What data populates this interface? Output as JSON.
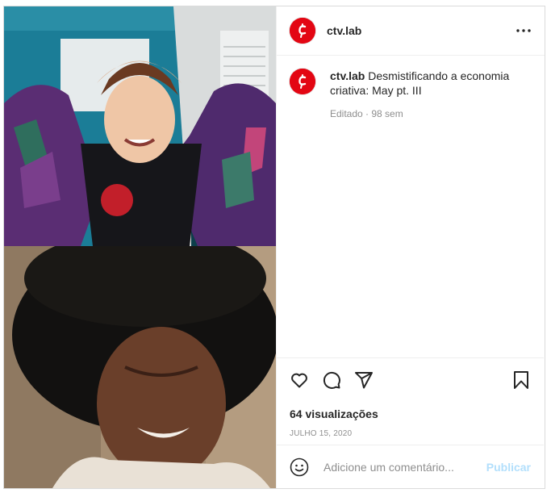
{
  "post": {
    "username": "ctv.lab",
    "more_icon": "more-horizontal-icon",
    "caption": {
      "username": "ctv.lab",
      "text": "Desmistificando a economia criativa: May pt. III"
    },
    "meta": "Editado · 98 sem",
    "views": "64 visualizações",
    "date": "JULHO 15, 2020",
    "comment_placeholder": "Adicione um comentário...",
    "publish_label": "Publicar",
    "icons": [
      "heart-icon",
      "comment-icon",
      "share-icon",
      "bookmark-icon",
      "emoji-icon"
    ],
    "colors": {
      "brand": "#e30613",
      "publish_disabled": "#b2dffc",
      "muted": "#8e8e8e"
    }
  }
}
